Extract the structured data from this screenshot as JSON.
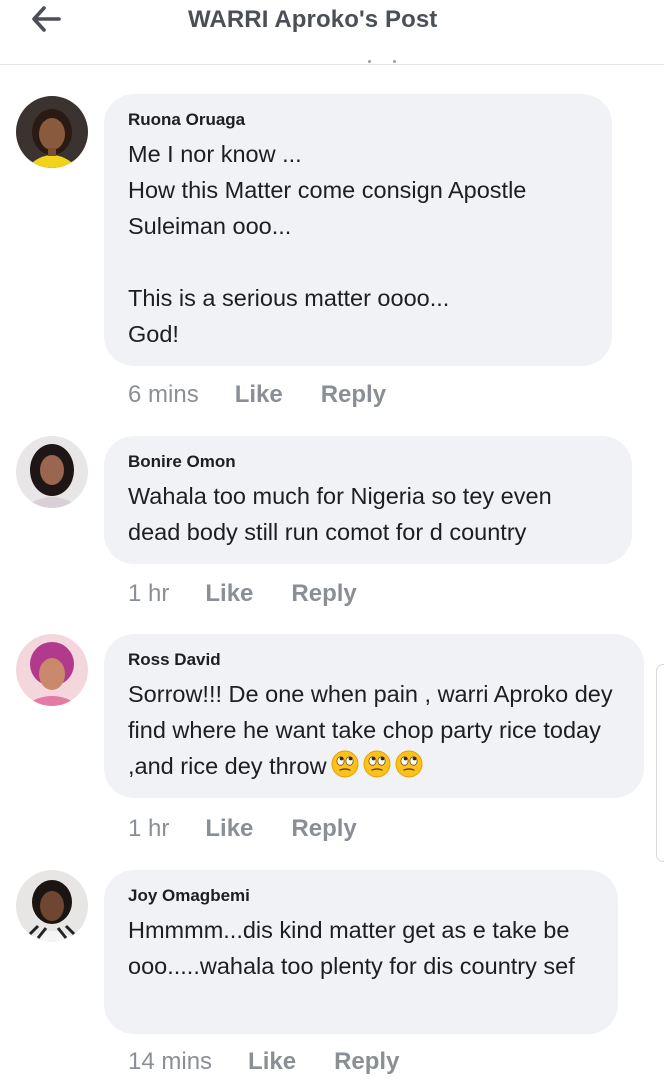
{
  "header": {
    "title": "WARRI Aproko's Post",
    "back_icon": "arrow-left-icon"
  },
  "comments": [
    {
      "author": "Ruona Oruaga",
      "text": "Me I nor know ...\nHow this Matter come consign Apostle Suleiman ooo...\n\nThis is a serious matter oooo...\nGod!",
      "time": "6 mins",
      "like_label": "Like",
      "reply_label": "Reply"
    },
    {
      "author": "Bonire Omon",
      "text": "Wahala too much for Nigeria so tey even dead body still run comot for d country",
      "time": "1 hr",
      "like_label": "Like",
      "reply_label": "Reply"
    },
    {
      "author": "Ross David",
      "text": "Sorrow!!! De one when pain , warri Aproko dey find where he want take chop party rice today ,and rice dey throw",
      "emojis": [
        "face-with-rolling-eyes-icon",
        "face-with-rolling-eyes-icon",
        "face-with-rolling-eyes-icon"
      ],
      "time": "1 hr",
      "like_label": "Like",
      "reply_label": "Reply"
    },
    {
      "author": "Joy Omagbemi",
      "text": "Hmmmm...dis kind matter get as e take be ooo.....wahala too plenty for dis country sef",
      "time": "14 mins",
      "like_label": "Like",
      "reply_label": "Reply"
    }
  ],
  "colors": {
    "bubble": "#f0f2f5",
    "meta_text": "#8a8f96",
    "title_text": "#4b4f56"
  }
}
